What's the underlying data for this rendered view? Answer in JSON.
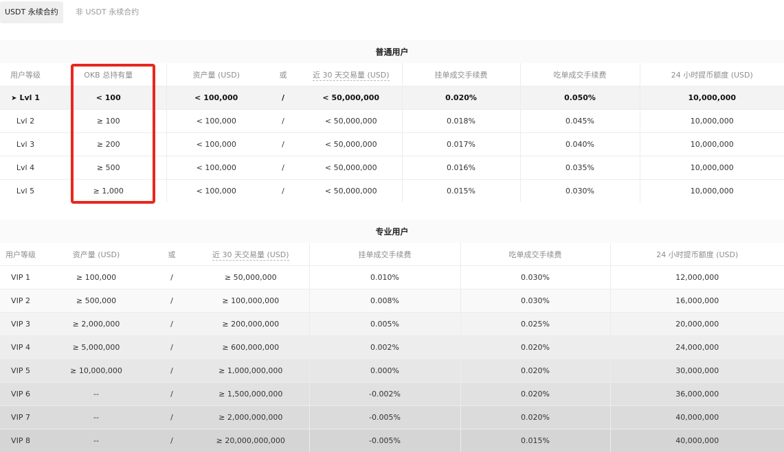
{
  "tabs": [
    "USDT 永续合约",
    "非 USDT 永续合约"
  ],
  "regular": {
    "title": "普通用户",
    "headers": [
      "用户等级",
      "OKB 总持有量",
      "资产量 (USD)",
      "或",
      "近 30 天交易量 (USD)",
      "挂单成交手续费",
      "吃单成交手续费",
      "24 小时提币额度 (USD)"
    ],
    "rows": [
      [
        "Lvl 1",
        "< 100",
        "< 100,000",
        "/",
        "< 50,000,000",
        "0.020%",
        "0.050%",
        "10,000,000"
      ],
      [
        "Lvl 2",
        "≥ 100",
        "< 100,000",
        "/",
        "< 50,000,000",
        "0.018%",
        "0.045%",
        "10,000,000"
      ],
      [
        "Lvl 3",
        "≥ 200",
        "< 100,000",
        "/",
        "< 50,000,000",
        "0.017%",
        "0.040%",
        "10,000,000"
      ],
      [
        "Lvl 4",
        "≥ 500",
        "< 100,000",
        "/",
        "< 50,000,000",
        "0.016%",
        "0.035%",
        "10,000,000"
      ],
      [
        "Lvl 5",
        "≥ 1,000",
        "< 100,000",
        "/",
        "< 50,000,000",
        "0.015%",
        "0.030%",
        "10,000,000"
      ]
    ],
    "current_level_marker": "➤"
  },
  "pro": {
    "title": "专业用户",
    "headers": [
      "用户等级",
      "资产量 (USD)",
      "或",
      "近 30 天交易量 (USD)",
      "挂单成交手续费",
      "吃单成交手续费",
      "24 小时提币额度 (USD)"
    ],
    "rows": [
      [
        "VIP 1",
        "≥ 100,000",
        "/",
        "≥ 50,000,000",
        "0.010%",
        "0.030%",
        "12,000,000"
      ],
      [
        "VIP 2",
        "≥ 500,000",
        "/",
        "≥ 100,000,000",
        "0.008%",
        "0.030%",
        "16,000,000"
      ],
      [
        "VIP 3",
        "≥ 2,000,000",
        "/",
        "≥ 200,000,000",
        "0.005%",
        "0.025%",
        "20,000,000"
      ],
      [
        "VIP 4",
        "≥ 5,000,000",
        "/",
        "≥ 600,000,000",
        "0.002%",
        "0.020%",
        "24,000,000"
      ],
      [
        "VIP 5",
        "≥ 10,000,000",
        "/",
        "≥ 1,000,000,000",
        "0.000%",
        "0.020%",
        "30,000,000"
      ],
      [
        "VIP 6",
        "--",
        "/",
        "≥ 1,500,000,000",
        "-0.002%",
        "0.020%",
        "36,000,000"
      ],
      [
        "VIP 7",
        "--",
        "/",
        "≥ 2,000,000,000",
        "-0.005%",
        "0.020%",
        "40,000,000"
      ],
      [
        "VIP 8",
        "--",
        "/",
        "≥ 20,000,000,000",
        "-0.005%",
        "0.015%",
        "40,000,000"
      ]
    ]
  },
  "colors": {
    "highlight_box": "#e8271e"
  }
}
